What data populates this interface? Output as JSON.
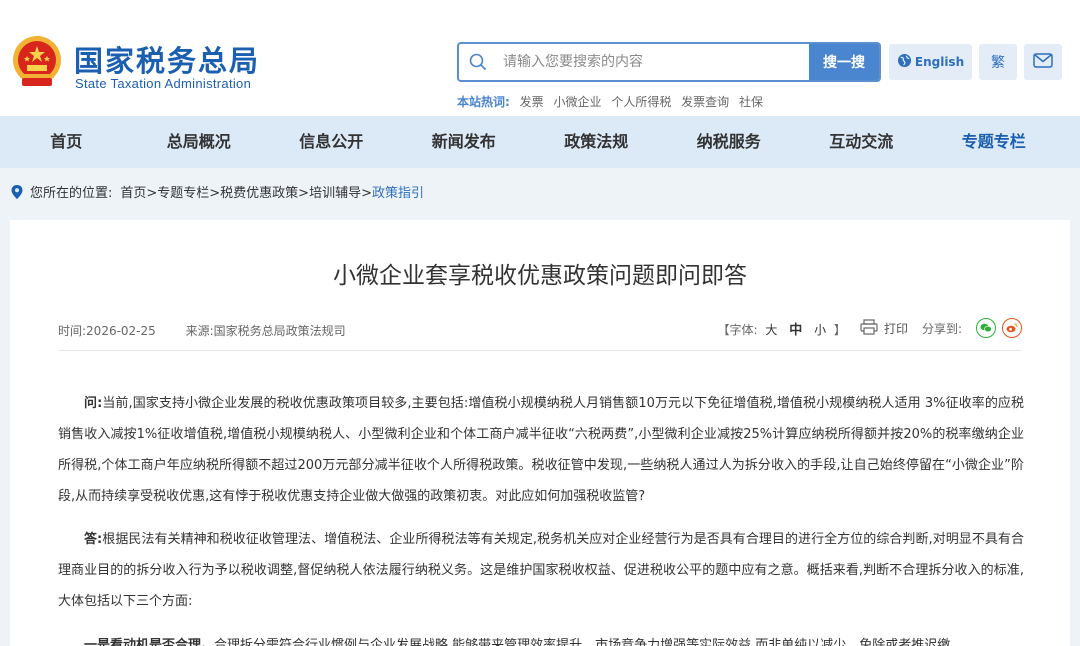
{
  "header": {
    "logo_cn": "国家税务总局",
    "logo_en": "State Taxation Administration",
    "search_placeholder": "请输入您要搜索的内容",
    "search_button": "搜一搜",
    "hot_label": "本站热词:",
    "hot_words": [
      "发票",
      "小微企业",
      "个人所得税",
      "发票查询",
      "社保"
    ],
    "english_label": "English",
    "traditional_label": "繁"
  },
  "nav": {
    "items": [
      {
        "label": "首页"
      },
      {
        "label": "总局概况"
      },
      {
        "label": "信息公开"
      },
      {
        "label": "新闻发布"
      },
      {
        "label": "政策法规"
      },
      {
        "label": "纳税服务"
      },
      {
        "label": "互动交流"
      },
      {
        "label": "专题专栏"
      }
    ],
    "active": "专题专栏"
  },
  "breadcrumb": {
    "label": "您所在的位置:",
    "path": "首页>专题专栏>税费优惠政策>培训辅导>",
    "current": "政策指引"
  },
  "article": {
    "title": "小微企业套享税收优惠政策问题即问即答",
    "time": "时间:2026-02-25",
    "source": "来源:国家税务总局政策法规司",
    "font_label_open": "【字体:",
    "font_large": "大",
    "font_mid": "中",
    "font_small": "小",
    "font_label_close": "】",
    "print_label": "打印",
    "share_label": "分享到:",
    "q_label": "问:",
    "q_text": "当前,国家支持小微企业发展的税收优惠政策项目较多,主要包括:增值税小规模纳税人月销售额10万元以下免征增值税,增值税小规模纳税人适用 3%征收率的应税销售收入减按1%征收增值税,增值税小规模纳税人、小型微利企业和个体工商户减半征收“六税两费”,小型微利企业减按25%计算应纳税所得额并按20%的税率缴纳企业所得税,个体工商户年应纳税所得额不超过200万元部分减半征收个人所得税政策。税收征管中发现,一些纳税人通过人为拆分收入的手段,让自己始终停留在“小微企业”阶段,从而持续享受税收优惠,这有悖于税收优惠支持企业做大做强的政策初衷。对此应如何加强税收监管?",
    "a_label": "答:",
    "a_text": "根据民法有关精神和税收征收管理法、增值税法、企业所得税法等有关规定,税务机关应对企业经营行为是否具有合理目的进行全方位的综合判断,对明显不具有合理商业目的的拆分收入行为予以税收调整,督促纳税人依法履行纳税义务。这是维护国家税收权益、促进税收公平的题中应有之意。概括来看,判断不合理拆分收入的标准,大体包括以下三个方面:",
    "p3_label": "一是看动机是否合理。",
    "p3_text": "合理拆分需符合行业惯例与企业发展战略,能够带来管理效率提升、市场竞争力增强等实际效益,而非单纯以减少、免除或者推迟缴"
  }
}
